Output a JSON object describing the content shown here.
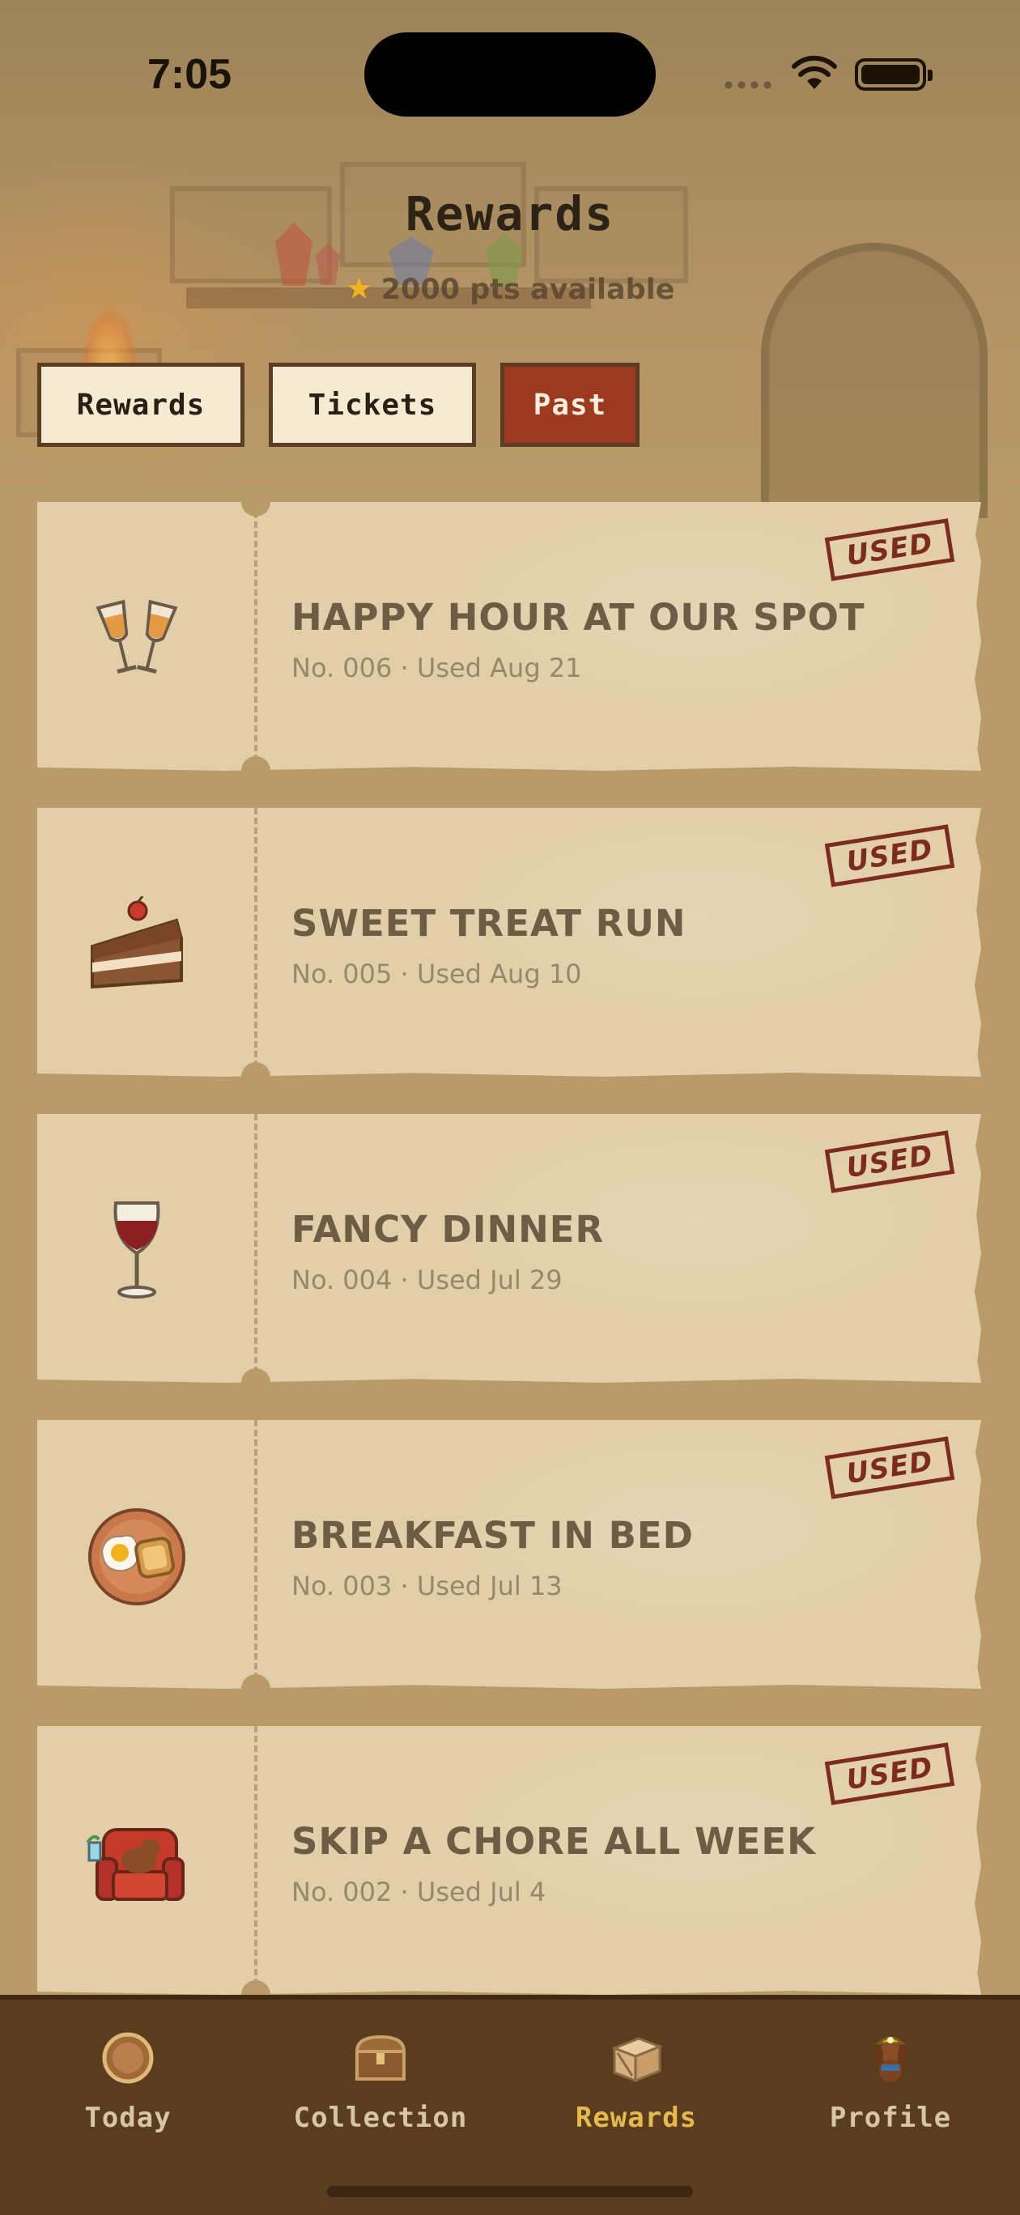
{
  "status_bar": {
    "time": "7:05"
  },
  "header": {
    "title": "Rewards",
    "points_text": "2000 pts available",
    "points_icon": "star-icon"
  },
  "tabs": [
    {
      "label": "Rewards",
      "active": false
    },
    {
      "label": "Tickets",
      "active": false
    },
    {
      "label": "Past",
      "active": true
    }
  ],
  "colors": {
    "background": "#b89b69",
    "ticket": "#e2cfaa",
    "active_tab": "#9c3a20",
    "inactive_tab": "#f5ebd2",
    "stamp": "#7c2c1f",
    "nav_background": "#5a3c1f",
    "nav_active": "#e4b94e",
    "nav_inactive": "#d8c6a3"
  },
  "tickets": [
    {
      "icon": "champagne-glasses-icon",
      "title": "HAPPY HOUR AT OUR SPOT",
      "number": "No. 006",
      "used": "Used Aug 21",
      "stamp": "USED"
    },
    {
      "icon": "cake-slice-icon",
      "title": "SWEET TREAT RUN",
      "number": "No. 005",
      "used": "Used Aug 10",
      "stamp": "USED"
    },
    {
      "icon": "wine-glass-icon",
      "title": "FANCY DINNER",
      "number": "No. 004",
      "used": "Used Jul 29",
      "stamp": "USED"
    },
    {
      "icon": "breakfast-plate-icon",
      "title": "BREAKFAST IN BED",
      "number": "No. 003",
      "used": "Used Jul 13",
      "stamp": "USED"
    },
    {
      "icon": "armchair-dog-icon",
      "title": "SKIP A CHORE ALL WEEK",
      "number": "No. 002",
      "used": "Used Jul 4",
      "stamp": "USED"
    }
  ],
  "bottom_nav": [
    {
      "label": "Today",
      "icon": "coin-icon",
      "active": false
    },
    {
      "label": "Collection",
      "icon": "treasure-chest-icon",
      "active": false
    },
    {
      "label": "Rewards",
      "icon": "crate-icon",
      "active": true
    },
    {
      "label": "Profile",
      "icon": "dog-miner-icon",
      "active": false
    }
  ]
}
